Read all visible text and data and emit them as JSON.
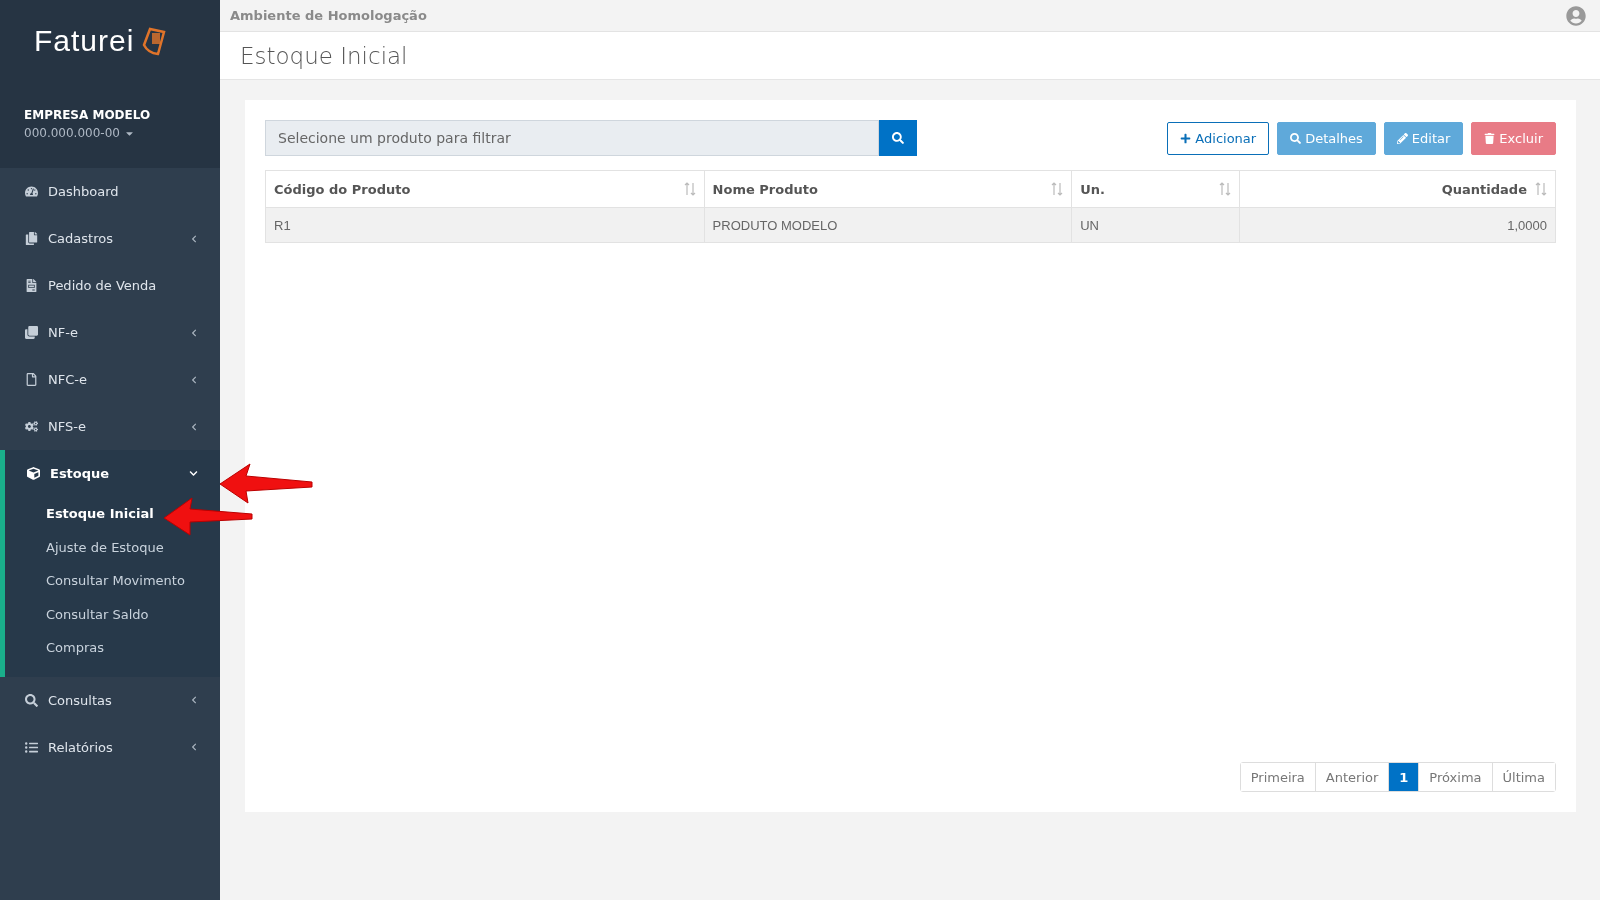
{
  "brand": {
    "name": "Faturei"
  },
  "company": {
    "name": "EMPRESA MODELO",
    "document": "000.000.000-00"
  },
  "sidebar": {
    "items": [
      {
        "label": "Dashboard"
      },
      {
        "label": "Cadastros",
        "expanded": false
      },
      {
        "label": "Pedido de Venda"
      },
      {
        "label": "NF-e",
        "expanded": false
      },
      {
        "label": "NFC-e",
        "expanded": false
      },
      {
        "label": "NFS-e",
        "expanded": false
      },
      {
        "label": "Estoque",
        "expanded": true,
        "children": [
          {
            "label": "Estoque Inicial",
            "selected": true
          },
          {
            "label": "Ajuste de Estoque",
            "selected": false
          },
          {
            "label": "Consultar Movimento",
            "selected": false
          },
          {
            "label": "Consultar Saldo",
            "selected": false
          },
          {
            "label": "Compras",
            "selected": false
          }
        ]
      },
      {
        "label": "Consultas",
        "expanded": false
      },
      {
        "label": "Relatórios",
        "expanded": false
      }
    ]
  },
  "top_bar": {
    "environment": "Ambiente de Homologação"
  },
  "page_title": "Estoque Inicial",
  "search": {
    "placeholder": "Selecione um produto para filtrar"
  },
  "actions": [
    {
      "label": "Adicionar",
      "kind": "add"
    },
    {
      "label": "Detalhes",
      "kind": "details"
    },
    {
      "label": "Editar",
      "kind": "edit"
    },
    {
      "label": "Excluir",
      "kind": "delete"
    }
  ],
  "table": {
    "columns": [
      "Código do Produto",
      "Nome Produto",
      "Un.",
      "Quantidade"
    ],
    "rows": [
      [
        "R1",
        "PRODUTO MODELO",
        "UN",
        "1,0000"
      ]
    ]
  },
  "pagination": [
    {
      "label": "Primeira",
      "selected": false
    },
    {
      "label": "Anterior",
      "selected": false
    },
    {
      "label": "1",
      "selected": true
    },
    {
      "label": "Próxima",
      "selected": false
    },
    {
      "label": "Última",
      "selected": false
    }
  ]
}
